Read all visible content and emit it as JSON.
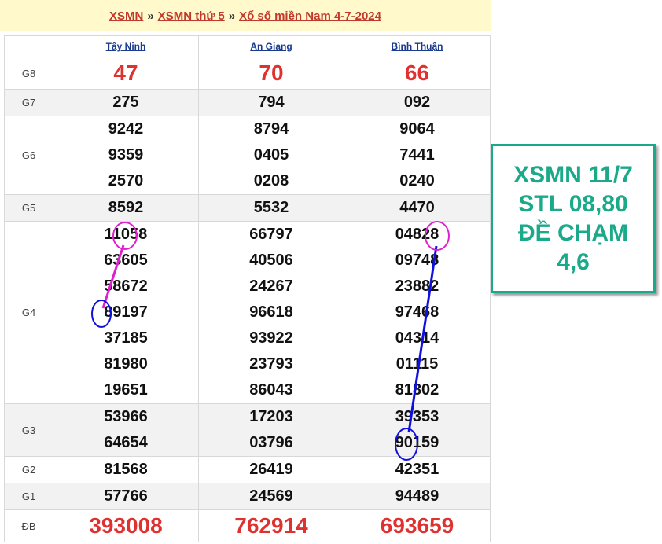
{
  "breadcrumb": {
    "item1": "XSMN",
    "item2": "XSMN thứ 5",
    "item3": "Xổ số miền Nam 4-7-2024",
    "separator": "»"
  },
  "table": {
    "headers": [
      "Tây Ninh",
      "An Giang",
      "Bình Thuận"
    ],
    "rows": [
      {
        "label": "G8",
        "values": [
          [
            "47"
          ],
          [
            "70"
          ],
          [
            "66"
          ]
        ]
      },
      {
        "label": "G7",
        "values": [
          [
            "275"
          ],
          [
            "794"
          ],
          [
            "092"
          ]
        ]
      },
      {
        "label": "G6",
        "values": [
          [
            "9242",
            "9359",
            "2570"
          ],
          [
            "8794",
            "0405",
            "0208"
          ],
          [
            "9064",
            "7441",
            "0240"
          ]
        ]
      },
      {
        "label": "G5",
        "values": [
          [
            "8592"
          ],
          [
            "5532"
          ],
          [
            "4470"
          ]
        ]
      },
      {
        "label": "G4",
        "values": [
          [
            "11058",
            "63605",
            "58672",
            "89197",
            "37185",
            "81980",
            "19651"
          ],
          [
            "66797",
            "40506",
            "24267",
            "96618",
            "93922",
            "23793",
            "86043"
          ],
          [
            "04828",
            "09748",
            "23882",
            "97468",
            "04314",
            "01115",
            "81802"
          ]
        ]
      },
      {
        "label": "G3",
        "values": [
          [
            "53966",
            "64654"
          ],
          [
            "17203",
            "03796"
          ],
          [
            "39353",
            "90159"
          ]
        ]
      },
      {
        "label": "G2",
        "values": [
          [
            "81568"
          ],
          [
            "26419"
          ],
          [
            "42351"
          ]
        ]
      },
      {
        "label": "G1",
        "values": [
          [
            "57766"
          ],
          [
            "24569"
          ],
          [
            "94489"
          ]
        ]
      },
      {
        "label": "ĐB",
        "values": [
          [
            "393008"
          ],
          [
            "762914"
          ],
          [
            "693659"
          ]
        ]
      }
    ]
  },
  "promo": {
    "line1": "XSMN 11/7",
    "line2": "STL 08,80",
    "line3": "ĐỀ CHẠM",
    "line4": "4,6"
  },
  "colors": {
    "link_red": "#c0392b",
    "link_blue": "#1a3a8f",
    "big_number_red": "#e03131",
    "promo_teal": "#1aaa8a",
    "circle_magenta": "#e020d0",
    "circle_blue": "#1010dd"
  }
}
